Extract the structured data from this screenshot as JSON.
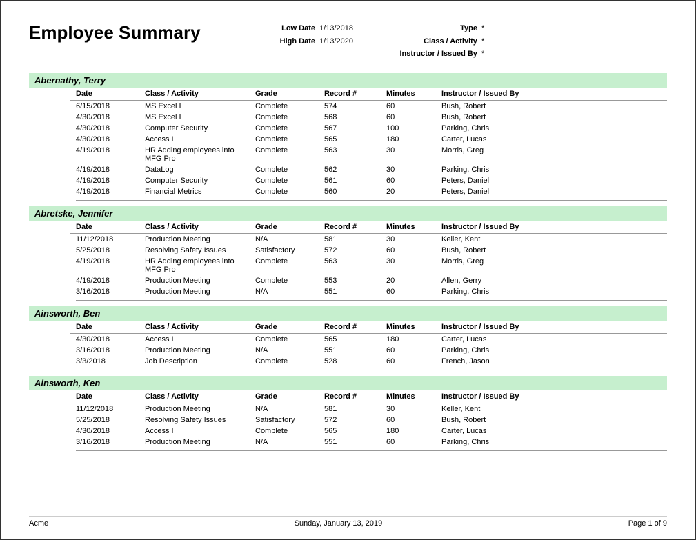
{
  "report": {
    "title": "Employee Summary",
    "lowDateLabel": "Low Date",
    "lowDate": "1/13/2018",
    "highDateLabel": "High Date",
    "highDate": "1/13/2020",
    "typeLabel": "Type",
    "typeValue": "*",
    "classActivityLabel": "Class / Activity",
    "classActivityValue": "*",
    "instructorLabel": "Instructor / Issued By",
    "instructorValue": "*"
  },
  "columns": {
    "date": "Date",
    "classActivity": "Class / Activity",
    "grade": "Grade",
    "recordNum": "Record #",
    "minutes": "Minutes",
    "instructor": "Instructor / Issued By"
  },
  "employees": [
    {
      "name": "Abernathy, Terry",
      "rows": [
        {
          "date": "6/15/2018",
          "activity": "MS Excel I",
          "grade": "Complete",
          "record": "574",
          "minutes": "60",
          "instructor": "Bush, Robert"
        },
        {
          "date": "4/30/2018",
          "activity": "MS Excel I",
          "grade": "Complete",
          "record": "568",
          "minutes": "60",
          "instructor": "Bush, Robert"
        },
        {
          "date": "4/30/2018",
          "activity": "Computer Security",
          "grade": "Complete",
          "record": "567",
          "minutes": "100",
          "instructor": "Parking, Chris"
        },
        {
          "date": "4/30/2018",
          "activity": "Access I",
          "grade": "Complete",
          "record": "565",
          "minutes": "180",
          "instructor": "Carter, Lucas"
        },
        {
          "date": "4/19/2018",
          "activity": "HR Adding employees into\nMFG Pro",
          "grade": "Complete",
          "record": "563",
          "minutes": "30",
          "instructor": "Morris, Greg",
          "multiline": true
        },
        {
          "date": "4/19/2018",
          "activity": "DataLog",
          "grade": "Complete",
          "record": "562",
          "minutes": "30",
          "instructor": "Parking, Chris"
        },
        {
          "date": "4/19/2018",
          "activity": "Computer Security",
          "grade": "Complete",
          "record": "561",
          "minutes": "60",
          "instructor": "Peters, Daniel"
        },
        {
          "date": "4/19/2018",
          "activity": "Financial Metrics",
          "grade": "Complete",
          "record": "560",
          "minutes": "20",
          "instructor": "Peters, Daniel"
        }
      ]
    },
    {
      "name": "Abretske, Jennifer",
      "rows": [
        {
          "date": "11/12/2018",
          "activity": "Production Meeting",
          "grade": "N/A",
          "record": "581",
          "minutes": "30",
          "instructor": "Keller, Kent"
        },
        {
          "date": "5/25/2018",
          "activity": "Resolving Safety Issues",
          "grade": "Satisfactory",
          "record": "572",
          "minutes": "60",
          "instructor": "Bush, Robert"
        },
        {
          "date": "4/19/2018",
          "activity": "HR Adding employees into\nMFG Pro",
          "grade": "Complete",
          "record": "563",
          "minutes": "30",
          "instructor": "Morris, Greg",
          "multiline": true
        },
        {
          "date": "4/19/2018",
          "activity": "Production Meeting",
          "grade": "Complete",
          "record": "553",
          "minutes": "20",
          "instructor": "Allen, Gerry"
        },
        {
          "date": "3/16/2018",
          "activity": "Production Meeting",
          "grade": "N/A",
          "record": "551",
          "minutes": "60",
          "instructor": "Parking, Chris"
        }
      ]
    },
    {
      "name": "Ainsworth, Ben",
      "rows": [
        {
          "date": "4/30/2018",
          "activity": "Access I",
          "grade": "Complete",
          "record": "565",
          "minutes": "180",
          "instructor": "Carter, Lucas"
        },
        {
          "date": "3/16/2018",
          "activity": "Production Meeting",
          "grade": "N/A",
          "record": "551",
          "minutes": "60",
          "instructor": "Parking, Chris"
        },
        {
          "date": "3/3/2018",
          "activity": "Job Description",
          "grade": "Complete",
          "record": "528",
          "minutes": "60",
          "instructor": "French, Jason"
        }
      ]
    },
    {
      "name": "Ainsworth, Ken",
      "rows": [
        {
          "date": "11/12/2018",
          "activity": "Production Meeting",
          "grade": "N/A",
          "record": "581",
          "minutes": "30",
          "instructor": "Keller, Kent"
        },
        {
          "date": "5/25/2018",
          "activity": "Resolving Safety Issues",
          "grade": "Satisfactory",
          "record": "572",
          "minutes": "60",
          "instructor": "Bush, Robert"
        },
        {
          "date": "4/30/2018",
          "activity": "Access I",
          "grade": "Complete",
          "record": "565",
          "minutes": "180",
          "instructor": "Carter, Lucas"
        },
        {
          "date": "3/16/2018",
          "activity": "Production Meeting",
          "grade": "N/A",
          "record": "551",
          "minutes": "60",
          "instructor": "Parking, Chris"
        }
      ]
    }
  ],
  "footer": {
    "company": "Acme",
    "date": "Sunday, January 13, 2019",
    "pageInfo": "Page 1 of 9"
  }
}
